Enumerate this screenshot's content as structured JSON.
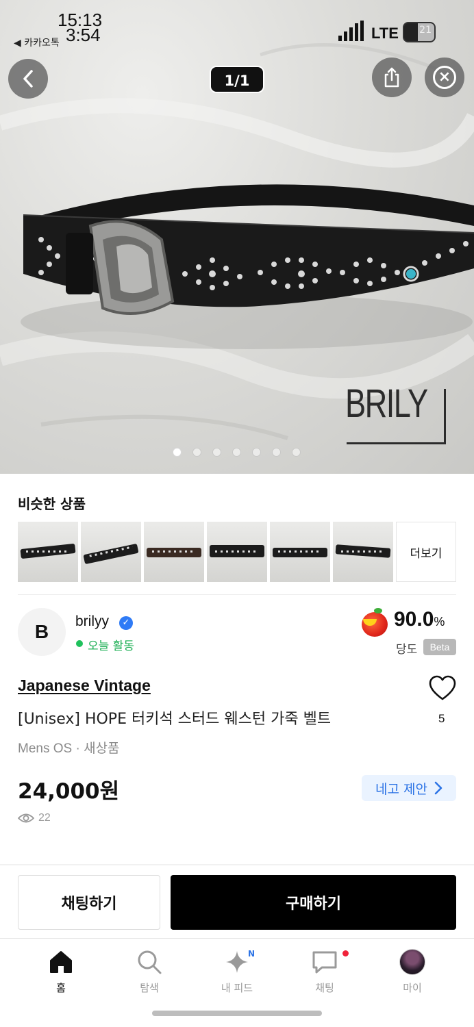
{
  "status_bar": {
    "time_overlay_1": "15:13",
    "time_overlay_2": "3:54",
    "back_app": "◀ 카카오톡",
    "network": "LTE",
    "battery": "21"
  },
  "gallery": {
    "counter": "1/1",
    "watermark": "BRILY",
    "dot_count": 7,
    "active_dot": 0
  },
  "similar": {
    "title": "비슷한 상품",
    "more": "더보기",
    "thumbnails": [
      "belt-1",
      "belt-2",
      "belt-3",
      "belt-4",
      "belt-5",
      "belt-6"
    ]
  },
  "seller": {
    "avatar_letter": "B",
    "name": "brilyy",
    "status": "오늘 활동",
    "score": "90.0",
    "score_unit": "%",
    "score_label": "당도",
    "score_badge": "Beta"
  },
  "product": {
    "brand": "Japanese Vintage",
    "title": "[Unisex] HOPE 터키석 스터드 웨스턴 가죽 벨트",
    "meta": "Mens OS · 새상품",
    "price": "24,000원",
    "likes": "5",
    "views": "22",
    "offer_label": "네고 제안"
  },
  "actions": {
    "chat": "채팅하기",
    "buy": "구매하기"
  },
  "tabbar": {
    "home": "홈",
    "explore": "탐색",
    "feed": "내 피드",
    "feed_badge": "N",
    "chat": "채팅",
    "my": "마이"
  },
  "colors": {
    "accent_blue": "#2a72e5",
    "active_green": "#1fc15c",
    "buy_button": "#000000",
    "notification_red": "#f0233a"
  }
}
